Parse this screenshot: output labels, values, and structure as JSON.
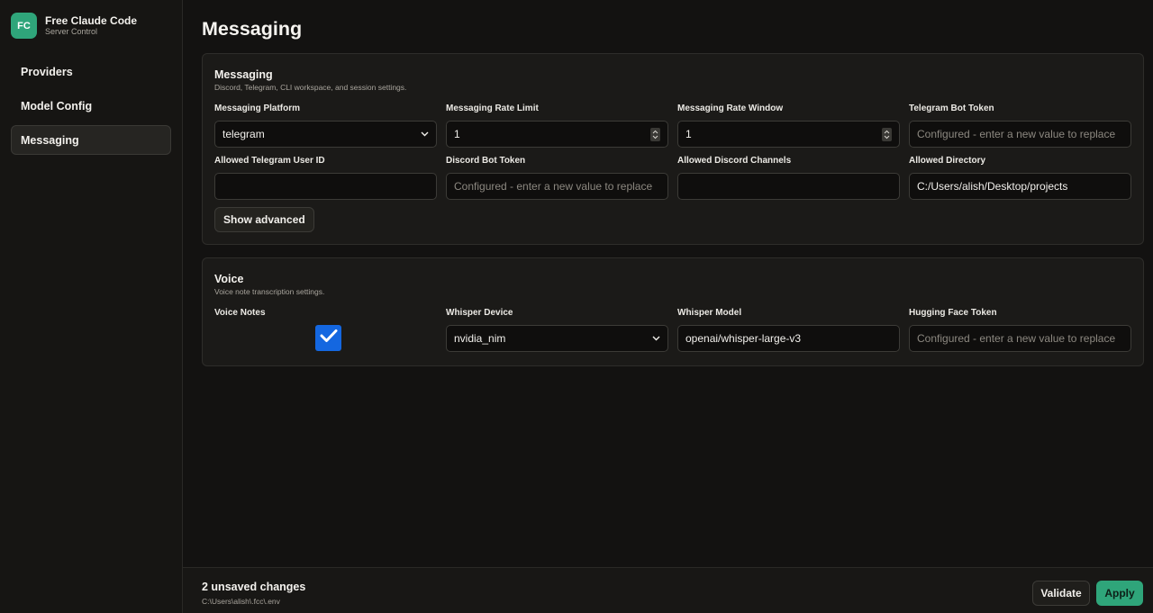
{
  "brand": {
    "logo_text": "FC",
    "name": "Free Claude Code",
    "subtitle": "Server Control",
    "color": "#2fa57a"
  },
  "nav": {
    "items": [
      {
        "label": "Providers",
        "active": false
      },
      {
        "label": "Model Config",
        "active": false
      },
      {
        "label": "Messaging",
        "active": true
      }
    ]
  },
  "page": {
    "title": "Messaging"
  },
  "messaging": {
    "title": "Messaging",
    "description": "Discord, Telegram, CLI workspace, and session settings.",
    "fields": {
      "platform": {
        "label": "Messaging Platform",
        "value": "telegram"
      },
      "rate_limit": {
        "label": "Messaging Rate Limit",
        "value": "1"
      },
      "rate_window": {
        "label": "Messaging Rate Window",
        "value": "1"
      },
      "telegram_token": {
        "label": "Telegram Bot Token",
        "placeholder": "Configured - enter a new value to replace"
      },
      "telegram_user": {
        "label": "Allowed Telegram User ID",
        "value": ""
      },
      "discord_token": {
        "label": "Discord Bot Token",
        "placeholder": "Configured - enter a new value to replace"
      },
      "discord_channels": {
        "label": "Allowed Discord Channels",
        "value": ""
      },
      "allowed_dir": {
        "label": "Allowed Directory",
        "value": "C:/Users/alish/Desktop/projects"
      }
    },
    "show_advanced_label": "Show advanced"
  },
  "voice": {
    "title": "Voice",
    "description": "Voice note transcription settings.",
    "fields": {
      "voice_notes": {
        "label": "Voice Notes",
        "checked": true
      },
      "whisper_device": {
        "label": "Whisper Device",
        "value": "nvidia_nim"
      },
      "whisper_model": {
        "label": "Whisper Model",
        "value": "openai/whisper-large-v3"
      },
      "hf_token": {
        "label": "Hugging Face Token",
        "placeholder": "Configured - enter a new value to replace"
      }
    }
  },
  "footer": {
    "unsaved": "2 unsaved changes",
    "path": "C:\\Users\\alish\\.fcc\\.env",
    "validate_label": "Validate",
    "apply_label": "Apply"
  },
  "icons": {
    "dropdown": "chevron-down-icon",
    "spinner": "spinner-arrows-icon",
    "check": "checkmark-icon"
  },
  "colors": {
    "accent": "#2fa57a",
    "checkbox": "#1467e0",
    "background": "#131211"
  }
}
